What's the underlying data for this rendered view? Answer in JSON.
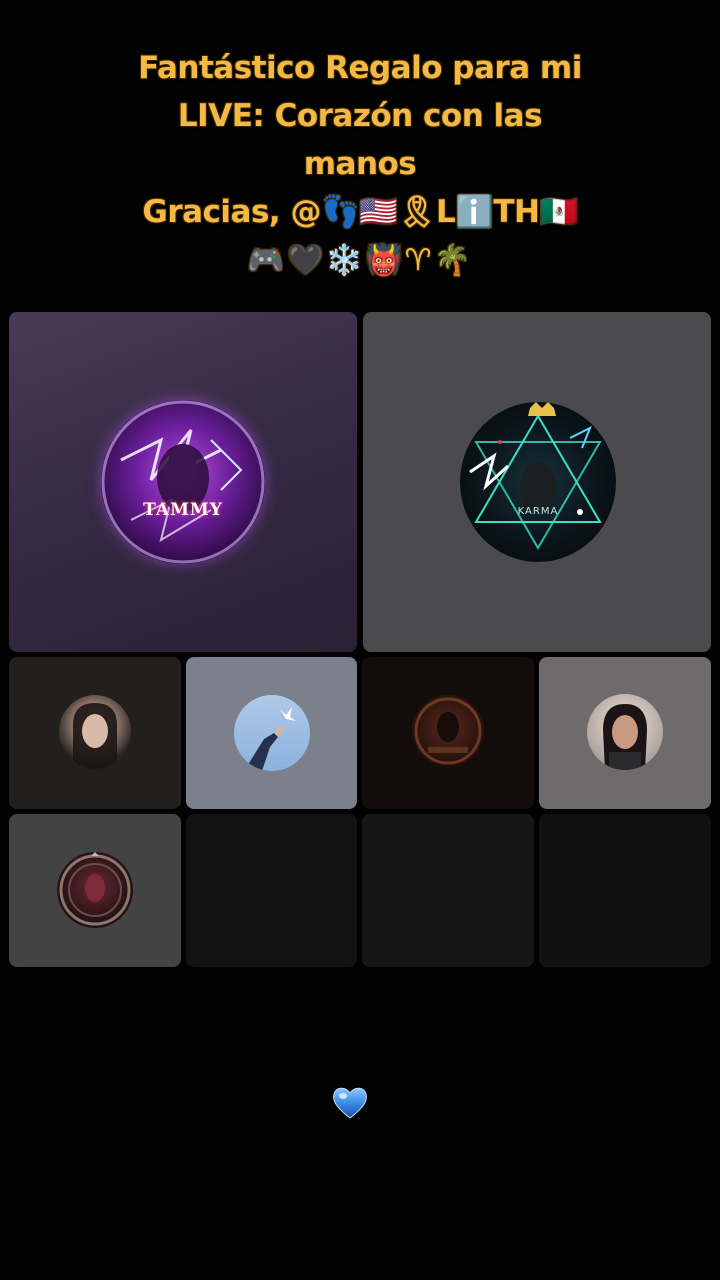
{
  "banner": {
    "line1": "Fantástico Regalo para mi",
    "line2": "LIVE: Corazón con las",
    "line3": "manos",
    "line4": "Gracias, @👣🇺🇸🎗Lℹ️TH🇲🇽",
    "line5": "🎮🖤❄️👹♈🌴"
  },
  "tiles": {
    "tammy": {
      "avatar_text": "TAMMY"
    },
    "karma": {
      "avatar_text": "KARMA"
    }
  },
  "colors": {
    "banner_text": "#f4b942",
    "background": "#020203",
    "heart": "#3b8be6"
  },
  "icons": {
    "floating": "blue-heart-icon"
  }
}
